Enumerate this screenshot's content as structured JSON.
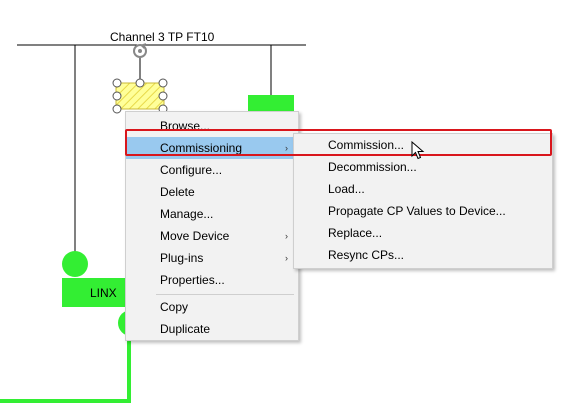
{
  "channel": {
    "label": "Channel 3 TP FT10"
  },
  "devices": {
    "linx_label": "LINX"
  },
  "context_menu": {
    "items": [
      {
        "label": "Browse...",
        "has_submenu": false
      },
      {
        "label": "Commissioning",
        "has_submenu": true,
        "highlighted": true
      },
      {
        "label": "Configure...",
        "has_submenu": false
      },
      {
        "label": "Delete",
        "has_submenu": false
      },
      {
        "label": "Manage...",
        "has_submenu": false
      },
      {
        "label": "Move Device",
        "has_submenu": true
      },
      {
        "label": "Plug-ins",
        "has_submenu": true
      },
      {
        "label": "Properties...",
        "has_submenu": false
      },
      {
        "label": "Copy",
        "has_submenu": false
      },
      {
        "label": "Duplicate",
        "has_submenu": false
      }
    ],
    "submenu_arrow": "›"
  },
  "commissioning_submenu": {
    "items": [
      {
        "label": "Commission..."
      },
      {
        "label": "Decommission..."
      },
      {
        "label": "Load..."
      },
      {
        "label": "Propagate CP Values to Device..."
      },
      {
        "label": "Replace..."
      },
      {
        "label": "Resync CPs..."
      }
    ]
  },
  "colors": {
    "device_green": "#33ee33",
    "bus_line": "#000000",
    "menu_background": "#f2f2f2",
    "highlight": "#99c9ef",
    "callout_red": "#d9161c",
    "selected_device_fill": "#ffff99"
  }
}
